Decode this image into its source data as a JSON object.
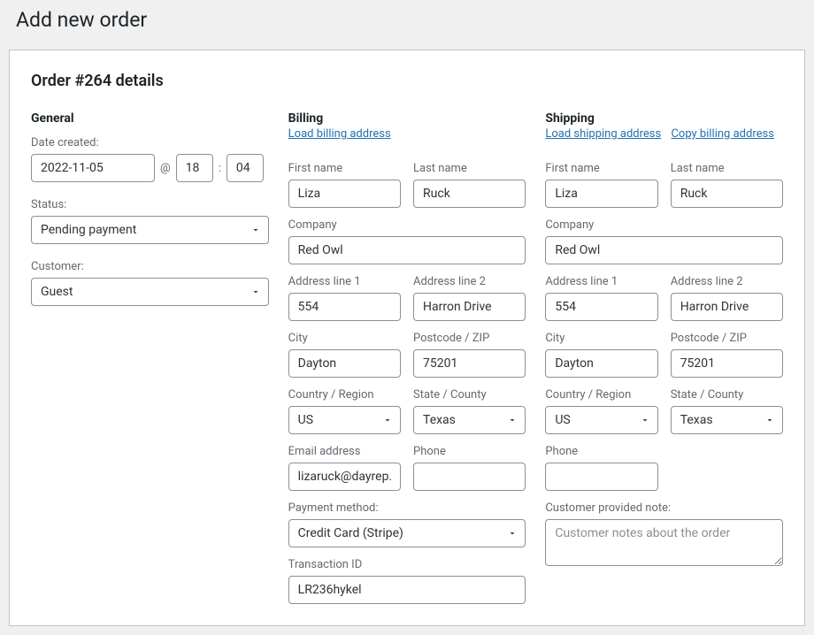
{
  "page_title": "Add new order",
  "panel_title": "Order #264 details",
  "general": {
    "heading": "General",
    "date_created_label": "Date created:",
    "date_value": "2022-11-05",
    "at_sep": "@",
    "hour_value": "18",
    "colon_sep": ":",
    "minute_value": "04",
    "status_label": "Status:",
    "status_value": "Pending payment",
    "customer_label": "Customer:",
    "customer_value": "Guest"
  },
  "billing": {
    "heading": "Billing",
    "load_link": "Load billing address",
    "first_name_label": "First name",
    "first_name_value": "Liza",
    "last_name_label": "Last name",
    "last_name_value": "Ruck",
    "company_label": "Company",
    "company_value": "Red Owl",
    "address1_label": "Address line 1",
    "address1_value": "554",
    "address2_label": "Address line 2",
    "address2_value": "Harron Drive",
    "city_label": "City",
    "city_value": "Dayton",
    "postcode_label": "Postcode / ZIP",
    "postcode_value": "75201",
    "country_label": "Country / Region",
    "country_value": "US",
    "state_label": "State / County",
    "state_value": "Texas",
    "email_label": "Email address",
    "email_value": "lizaruck@dayrep.com",
    "phone_label": "Phone",
    "phone_value": "",
    "payment_method_label": "Payment method:",
    "payment_method_value": "Credit Card (Stripe)",
    "transaction_id_label": "Transaction ID",
    "transaction_id_value": "LR236hykel"
  },
  "shipping": {
    "heading": "Shipping",
    "load_link": "Load shipping address",
    "copy_link": "Copy billing address",
    "first_name_label": "First name",
    "first_name_value": "Liza",
    "last_name_label": "Last name",
    "last_name_value": "Ruck",
    "company_label": "Company",
    "company_value": "Red Owl",
    "address1_label": "Address line 1",
    "address1_value": "554",
    "address2_label": "Address line 2",
    "address2_value": "Harron Drive",
    "city_label": "City",
    "city_value": "Dayton",
    "postcode_label": "Postcode / ZIP",
    "postcode_value": "75201",
    "country_label": "Country / Region",
    "country_value": "US",
    "state_label": "State / County",
    "state_value": "Texas",
    "phone_label": "Phone",
    "phone_value": "",
    "note_label": "Customer provided note:",
    "note_placeholder": "Customer notes about the order",
    "note_value": ""
  }
}
